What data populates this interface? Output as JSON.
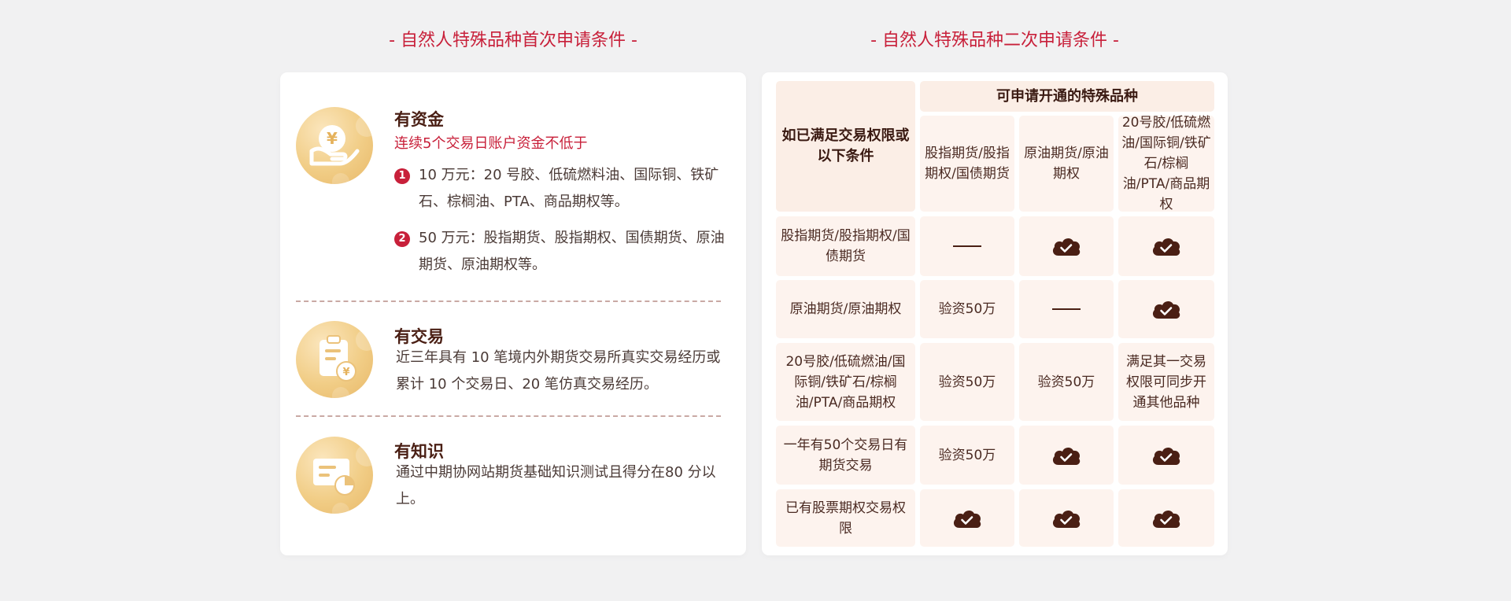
{
  "left": {
    "title": "- 自然人特殊品种首次申请条件 -",
    "conditions": [
      {
        "icon": "yen-hand-icon",
        "heading": "有资金",
        "subtitle": "连续5个交易日账户资金不低于",
        "items": [
          {
            "num": "1",
            "text": "10 万元：20 号胶、低硫燃料油、国际铜、铁矿石、棕榈油、PTA、商品期权等。"
          },
          {
            "num": "2",
            "text": "50 万元：股指期货、股指期权、国债期货、原油期货、原油期权等。"
          }
        ]
      },
      {
        "icon": "clipboard-yen-icon",
        "heading": "有交易",
        "text": "近三年具有 10 笔境内外期货交易所真实交易经历或累计 10 个交易日、20 笔仿真交易经历。"
      },
      {
        "icon": "chart-card-icon",
        "heading": "有知识",
        "text": "通过中期协网站期货基础知识测试且得分在80 分以上。"
      }
    ]
  },
  "right": {
    "title": "- 自然人特殊品种二次申请条件 -",
    "corner_header": "如已满足交易权限或以下条件",
    "group_header": "可申请开通的特殊品种",
    "columns": [
      "股指期货/股指期权/国债期货",
      "原油期货/原油期权",
      "20号胶/低硫燃油/国际铜/铁矿石/棕榈油/PTA/商品期权"
    ],
    "rows": [
      {
        "label": "股指期货/股指期权/国债期货",
        "cells": [
          "dash",
          "check",
          "check"
        ]
      },
      {
        "label": "原油期货/原油期权",
        "cells": [
          "验资50万",
          "dash",
          "check"
        ]
      },
      {
        "label": "20号胶/低硫燃油/国际铜/铁矿石/棕榈油/PTA/商品期权",
        "cells": [
          "验资50万",
          "验资50万",
          "满足其一交易权限可同步开通其他品种"
        ]
      },
      {
        "label": "一年有50个交易日有期货交易",
        "cells": [
          "验资50万",
          "check",
          "check"
        ]
      },
      {
        "label": "已有股票期权交易权限",
        "cells": [
          "check",
          "check",
          "check"
        ]
      }
    ]
  },
  "colors": {
    "accent": "#c8203a",
    "dark_brown": "#4a1f14",
    "cell_bg": "#fdf3ee",
    "icon_gold": "#f1cd86"
  }
}
